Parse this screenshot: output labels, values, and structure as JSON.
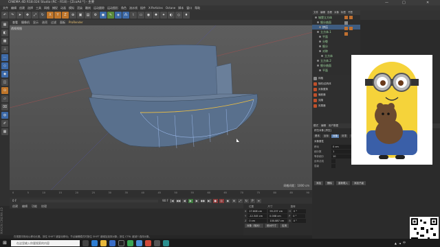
{
  "window": {
    "title": "CINEMA 4D R18.024 Studio (RC - R18) - [ZcoAd *] - 主要",
    "controls": [
      "—",
      "□",
      "✕"
    ]
  },
  "menubar": {
    "items": [
      "文件",
      "编辑",
      "创建",
      "选择",
      "工具",
      "网格",
      "捕捉",
      "动画",
      "模拟",
      "渲染",
      "雕刻",
      "运动跟踪",
      "运动图形",
      "角色",
      "流水线",
      "插件",
      "X-Particles",
      "Octane",
      "脚本",
      "窗口",
      "帮助"
    ]
  },
  "viewport": {
    "menu": [
      "查看",
      "摄像机",
      "显示",
      "选项",
      "过滤",
      "面板",
      "ProRender"
    ],
    "label": "透视视图",
    "grid_info": "网格间距：1000 cm"
  },
  "timeline": {
    "ticks": [
      "0",
      "5",
      "10",
      "15",
      "20",
      "25",
      "30",
      "35",
      "40",
      "45",
      "50",
      "55",
      "60",
      "65",
      "70",
      "75",
      "80",
      "85",
      "90"
    ],
    "frame_start": "0 F",
    "frame_end": "90 F",
    "end_label": "0 F"
  },
  "material_panel": {
    "menu": [
      "创建",
      "编辑",
      "功能",
      "纹理"
    ]
  },
  "coordinates": {
    "headers": [
      "位置",
      "尺寸",
      "旋转"
    ],
    "rows": [
      {
        "a": "X",
        "pos": "27.608 cm",
        "size": "95.237 cm",
        "rl": "H",
        "rot": "0 °"
      },
      {
        "a": "Y",
        "pos": "-12.345 cm",
        "size": "0.008 cm",
        "rl": "P",
        "rot": "0 °"
      },
      {
        "a": "Z",
        "pos": "0 cm",
        "size": "100.887 cm",
        "rl": "B",
        "rot": "0 °"
      }
    ],
    "mode": "对象（相对）",
    "size_mode": "绝对尺寸",
    "apply": "应用"
  },
  "statusbar": {
    "text": "在视图中拖动以移动元素。按住 SHIFT 键量化移动；节点编辑模式时按住 SHIFT 键增加选择对象；按住 CTRL 键减少选择对象。"
  },
  "side_vertical": "MAXON CINEMA 4D",
  "object_manager": {
    "menu": [
      "文件",
      "编辑",
      "查看",
      "对象",
      "标签",
      "书签"
    ],
    "rows": [
      "城堡立方体",
      "细分曲面",
      "挤压",
      "立方体.1",
      "平面",
      "分裂",
      "细分",
      "对称",
      "立方体",
      "立方体.2",
      "细分曲面",
      "平面"
    ]
  },
  "content_browser": {
    "rows": [
      "网格",
      "随机/结构体",
      "对象置换",
      "偏差器",
      "克隆",
      "效果器"
    ]
  },
  "attribute_manager": {
    "menu": [
      "模式",
      "编辑",
      "用户数据"
    ],
    "title": "挤压对象 [挤压]",
    "tabs": [
      "基本",
      "坐标",
      "对象",
      "封顶",
      "平滑着色"
    ],
    "section": "对象属性",
    "rows": [
      {
        "label": "移动",
        "v1": "0 cm",
        "v2": "1 cm",
        "v3": "0 cm"
      },
      {
        "label": "细分数",
        "v1": "1"
      },
      {
        "label": "等参细分",
        "v1": "10"
      },
      {
        "label": "反转法线",
        "v1": ""
      },
      {
        "label": "层级",
        "v1": ""
      }
    ],
    "buttons": [
      "添加",
      "删除",
      "重新载入",
      "添加子级"
    ]
  },
  "taskbar": {
    "search": "在这里输入你要搜索的内容"
  }
}
